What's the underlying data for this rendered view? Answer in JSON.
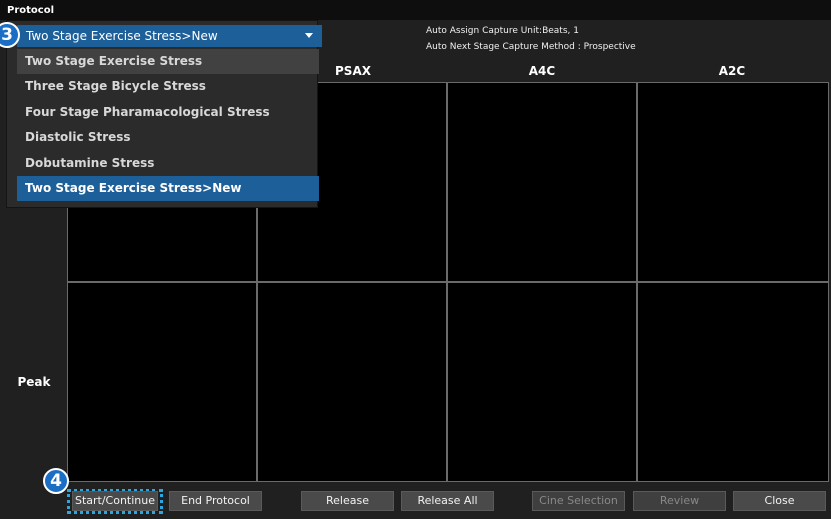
{
  "window": {
    "title": "Protocol"
  },
  "info": {
    "line1": "Auto Assign Capture Unit:Beats, 1",
    "line2": "Auto Next Stage Capture Method : Prospective"
  },
  "grid": {
    "columns": [
      "PSAX",
      "A4C",
      "A2C"
    ],
    "rows": [
      "Peak"
    ]
  },
  "protocol_dropdown": {
    "selected": "Two Stage Exercise Stress>New",
    "options": [
      "Two Stage Exercise Stress",
      "Three Stage Bicycle Stress",
      "Four Stage Pharamacological Stress",
      "Diastolic Stress",
      "Dobutamine Stress",
      "Two Stage Exercise Stress>New"
    ]
  },
  "callouts": {
    "step3": "3",
    "step4": "4"
  },
  "buttons": {
    "start_continue": "Start/Continue",
    "end_protocol": "End Protocol",
    "release": "Release",
    "release_all": "Release All",
    "cine_selection": "Cine Selection",
    "review": "Review",
    "close": "Close"
  },
  "colors": {
    "accent": "#1d5f99",
    "callout": "#1a6fc4",
    "highlight": "#2aa6e0"
  }
}
